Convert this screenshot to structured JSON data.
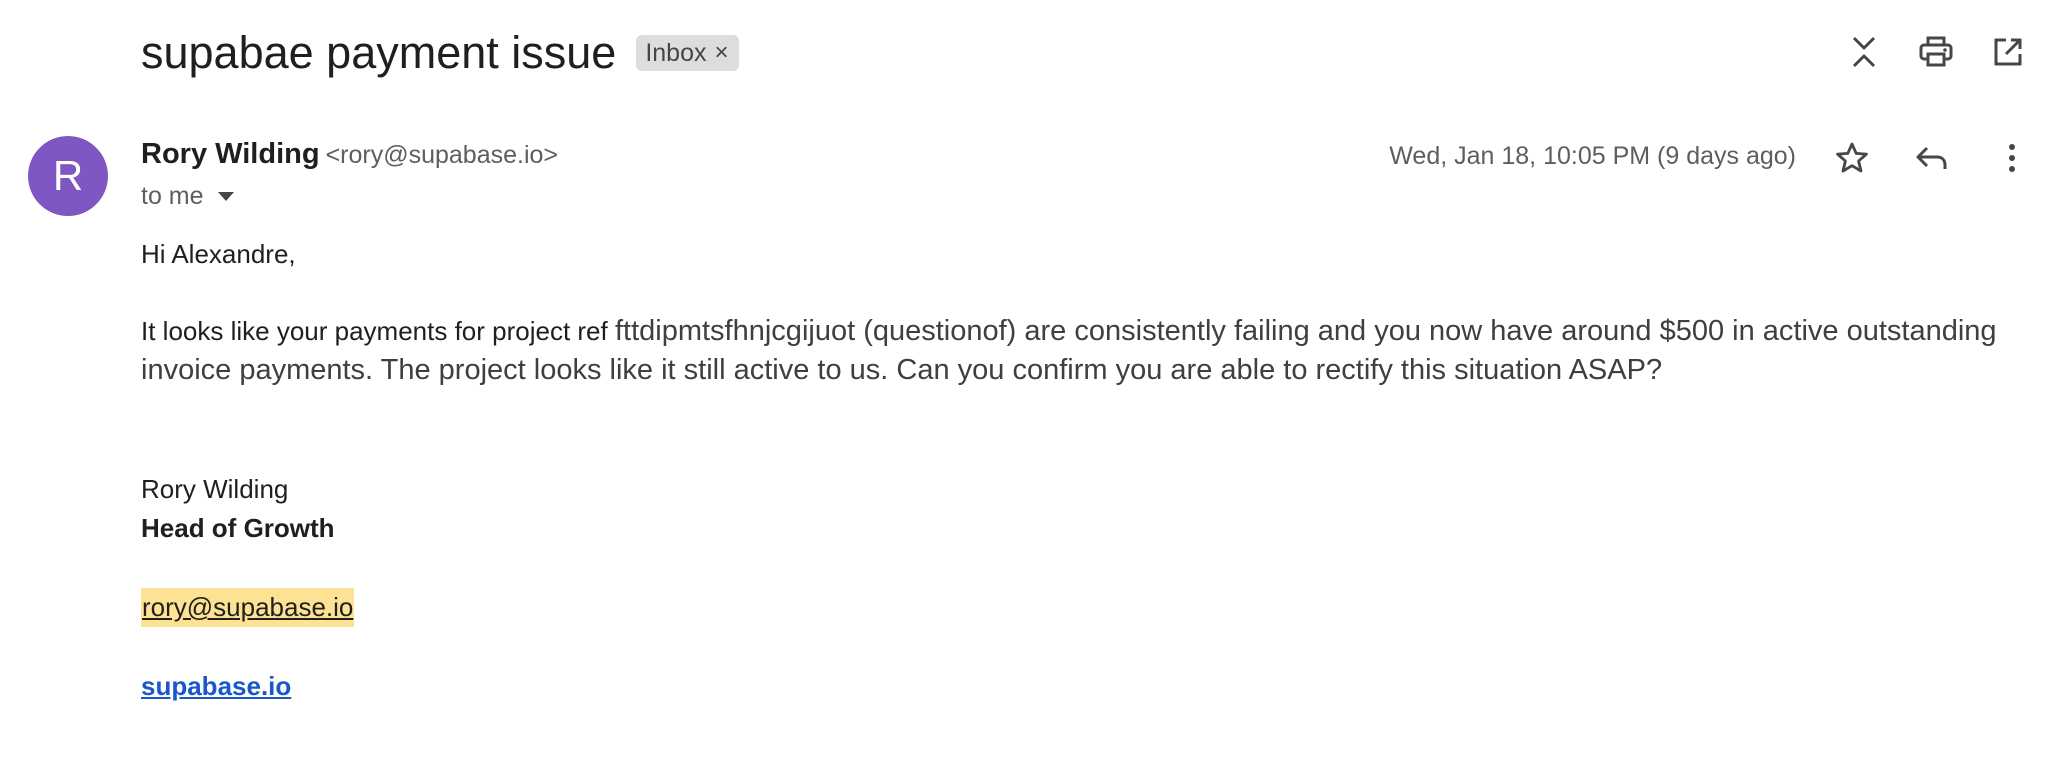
{
  "email": {
    "subject": "supabae payment issue",
    "label": "Inbox",
    "sender": {
      "initial": "R",
      "name": "Rory Wilding",
      "email": "<rory@supabase.io>",
      "avatar_color": "#7e57c2"
    },
    "recipient_label": "to me",
    "date": "Wed, Jan 18, 10:05 PM (9 days ago)",
    "body": {
      "greeting": "Hi Alexandre,",
      "paragraph_lead": "It looks like your payments for project ref ",
      "paragraph_rest": "fttdipmtsfhnjcgijuot (questionof) are consistently failing and you now have around $500 in active outstanding invoice payments. The project looks like it still active to us. Can you confirm you are able to rectify this situation ASAP?"
    },
    "signature": {
      "name": "Rory Wilding",
      "title": "Head of Growth",
      "email": "rory@supabase.io",
      "website": "supabase.io"
    }
  },
  "icons": {
    "top": [
      "collapse-all-icon",
      "print-icon",
      "open-in-new-window-icon"
    ],
    "message": [
      "star-icon",
      "reply-icon",
      "more-vert-icon"
    ]
  },
  "colors": {
    "highlight": "#fde293",
    "link": "#1a57c9",
    "chip": "#dddddd"
  }
}
